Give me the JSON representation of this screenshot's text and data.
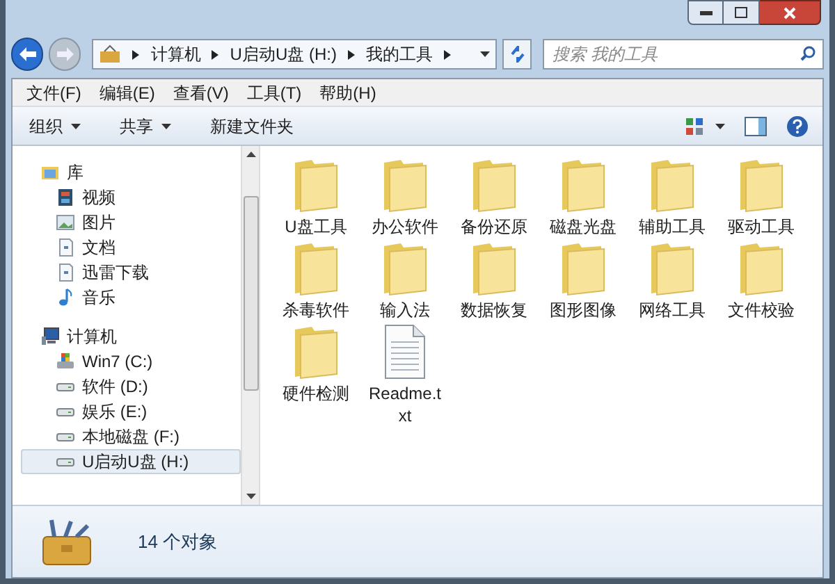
{
  "address": {
    "crumbs": [
      "计算机",
      "U启动U盘 (H:)",
      "我的工具"
    ],
    "search_placeholder": "搜索 我的工具"
  },
  "menu": [
    "文件(F)",
    "编辑(E)",
    "查看(V)",
    "工具(T)",
    "帮助(H)"
  ],
  "toolbar": [
    {
      "label": "组织",
      "has_menu": true
    },
    {
      "label": "共享",
      "has_menu": true
    },
    {
      "label": "新建文件夹",
      "has_menu": false
    }
  ],
  "nav": [
    {
      "label": "库",
      "kind": "library",
      "selected": false,
      "children": [
        {
          "label": "视频",
          "kind": "video",
          "selected": false
        },
        {
          "label": "图片",
          "kind": "picture",
          "selected": false
        },
        {
          "label": "文档",
          "kind": "document",
          "selected": false
        },
        {
          "label": "迅雷下载",
          "kind": "document",
          "selected": false
        },
        {
          "label": "音乐",
          "kind": "music",
          "selected": false
        }
      ]
    },
    {
      "label": "计算机",
      "kind": "computer",
      "selected": false,
      "children": [
        {
          "label": "Win7 (C:)",
          "kind": "system-drive",
          "selected": false
        },
        {
          "label": "软件 (D:)",
          "kind": "drive",
          "selected": false
        },
        {
          "label": "娱乐 (E:)",
          "kind": "drive",
          "selected": false
        },
        {
          "label": "本地磁盘 (F:)",
          "kind": "drive",
          "selected": false
        },
        {
          "label": "U启动U盘 (H:)",
          "kind": "drive",
          "selected": true
        }
      ]
    }
  ],
  "files": [
    {
      "name": "U盘工具",
      "kind": "folder"
    },
    {
      "name": "办公软件",
      "kind": "folder"
    },
    {
      "name": "备份还原",
      "kind": "folder"
    },
    {
      "name": "磁盘光盘",
      "kind": "folder"
    },
    {
      "name": "辅助工具",
      "kind": "folder"
    },
    {
      "name": "驱动工具",
      "kind": "folder"
    },
    {
      "name": "杀毒软件",
      "kind": "folder"
    },
    {
      "name": "输入法",
      "kind": "folder"
    },
    {
      "name": "数据恢复",
      "kind": "folder"
    },
    {
      "name": "图形图像",
      "kind": "folder"
    },
    {
      "name": "网络工具",
      "kind": "folder"
    },
    {
      "name": "文件校验",
      "kind": "folder"
    },
    {
      "name": "硬件检测",
      "kind": "folder"
    },
    {
      "name": "Readme.txt",
      "kind": "text"
    }
  ],
  "status": "14 个对象"
}
